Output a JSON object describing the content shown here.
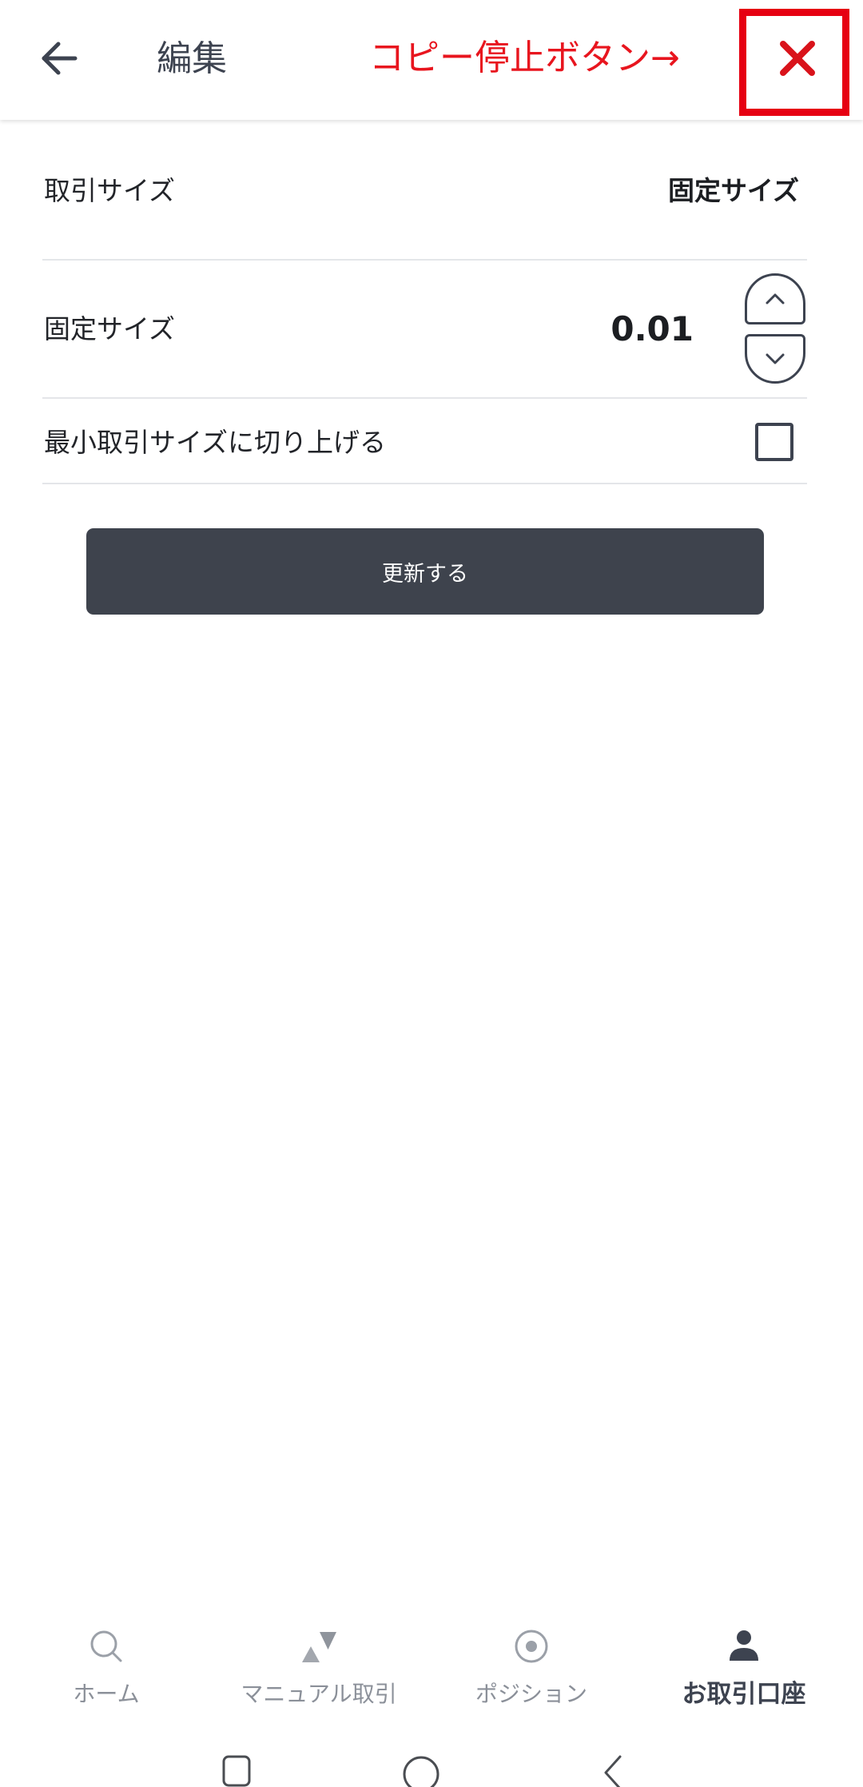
{
  "header": {
    "back_icon": "arrow-left-icon",
    "title": "編集",
    "annotation": "コピー停止ボタン→",
    "close_icon": "close-x-icon"
  },
  "colors": {
    "annotation_red": "#e60012",
    "text_dark": "#3d4350",
    "button_bg": "#3e434d",
    "nav_inactive": "#8b9099"
  },
  "settings": {
    "trade_size": {
      "label": "取引サイズ",
      "value": "固定サイズ"
    },
    "fixed_size": {
      "label": "固定サイズ",
      "value": "0.01",
      "up_icon": "chevron-up-icon",
      "down_icon": "chevron-down-icon"
    },
    "round_up": {
      "label": "最小取引サイズに切り上げる",
      "checked": false
    }
  },
  "update_button": {
    "label": "更新する"
  },
  "bottom_nav": {
    "items": [
      {
        "label": "ホーム",
        "icon": "search-icon",
        "active": false
      },
      {
        "label": "マニュアル取引",
        "icon": "up-down-triangles-icon",
        "active": false
      },
      {
        "label": "ポジション",
        "icon": "target-icon",
        "active": false
      },
      {
        "label": "お取引口座",
        "icon": "person-icon",
        "active": true
      }
    ]
  },
  "system_nav": {
    "icons": [
      "recent-apps-icon",
      "home-circle-icon",
      "system-back-icon"
    ]
  }
}
